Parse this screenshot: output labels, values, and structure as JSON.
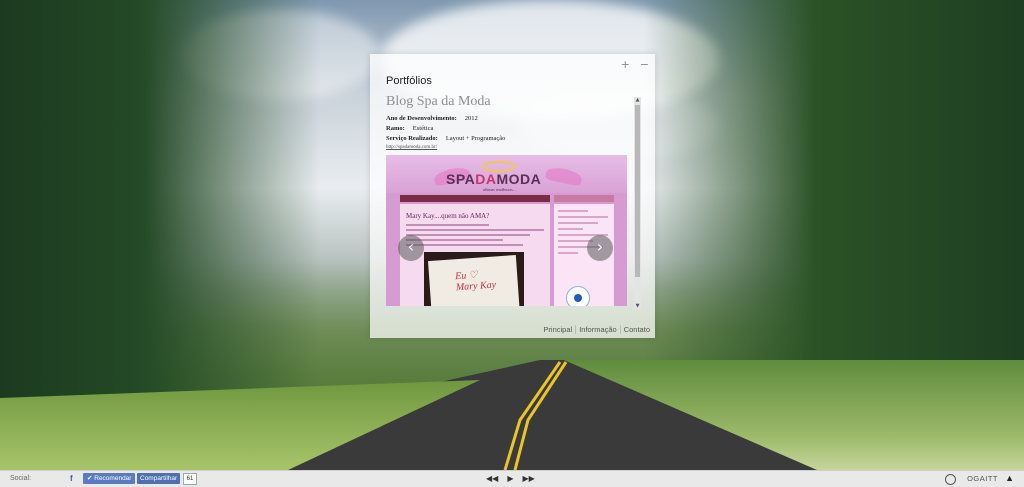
{
  "panel": {
    "title": "Portfólios",
    "window_controls": [
      "+",
      "−"
    ],
    "blog_title": "Blog Spa da Moda",
    "meta": [
      {
        "label": "Ano de Desenvolvimento:",
        "value": "2012"
      },
      {
        "label": "Ramo:",
        "value": "Estética"
      },
      {
        "label": "Serviço Realizado:",
        "value": "Layout + Programação"
      }
    ],
    "link": "http://spadamoda.com.br/",
    "screenshot": {
      "logo_main": "SPA",
      "logo_da": "DA",
      "logo_end": "MODA",
      "tagline": "ultimas tendências...",
      "post_title": "Mary Kay....quem não AMA?",
      "image_text": "Eu ♡\nMary Kay"
    },
    "arrows": {
      "prev": "‹",
      "next": "›"
    },
    "tabs": [
      "Principal",
      "Informação",
      "Contato"
    ]
  },
  "bottom_bar": {
    "social_label": "Social:",
    "facebook_icon": "f",
    "recommend_label": "✔ Recomendar",
    "share_label": "Compartilhar",
    "share_count": "61",
    "player": {
      "prev": "◀◀",
      "play": "▶",
      "next": "▶▶"
    },
    "brand": "OGAITT",
    "scroll_top": "▲"
  }
}
